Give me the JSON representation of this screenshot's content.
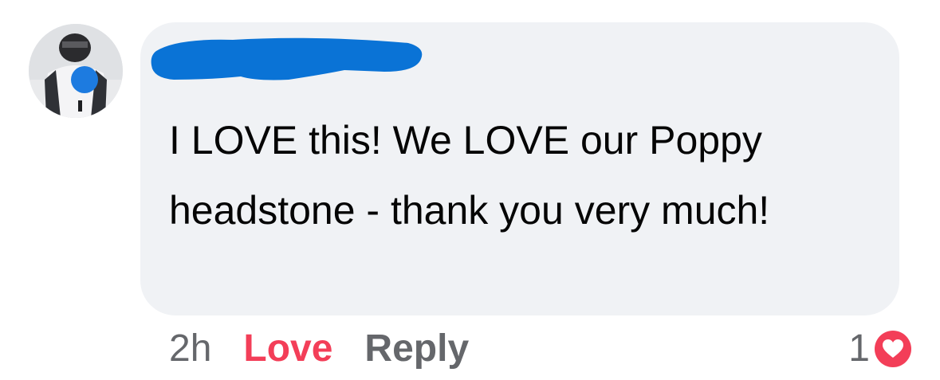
{
  "comment": {
    "author_name": "",
    "text": "I LOVE this! We LOVE our Poppy headstone - thank you very much!",
    "timestamp": "2h",
    "love_label": "Love",
    "reply_label": "Reply",
    "reaction_count": "1",
    "reaction_icon": "heart-reaction-icon"
  },
  "colors": {
    "bubble": "#f0f2f5",
    "love": "#f33e58",
    "muted": "#65676b",
    "text": "#050505",
    "redaction": "#0a73d6"
  }
}
